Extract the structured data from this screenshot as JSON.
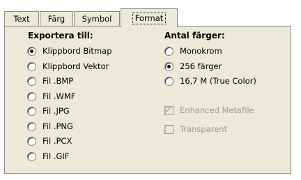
{
  "tabs": [
    {
      "label": "Text"
    },
    {
      "label": "Färg"
    },
    {
      "label": "Symbol"
    },
    {
      "label": "Format"
    }
  ],
  "export": {
    "title": "Exportera till:",
    "options": [
      {
        "label": "Klippbord Bitmap",
        "checked": true
      },
      {
        "label": "Klippbord Vektor",
        "checked": false
      },
      {
        "label": "Fil .BMP",
        "checked": false
      },
      {
        "label": "Fil .WMF",
        "checked": false
      },
      {
        "label": "Fil .JPG",
        "checked": false
      },
      {
        "label": "Fil .PNG",
        "checked": false
      },
      {
        "label": "Fil .PCX",
        "checked": false
      },
      {
        "label": "Fil .GIF",
        "checked": false
      }
    ]
  },
  "colors": {
    "title": "Antal färger:",
    "options": [
      {
        "label": "Monokrom",
        "checked": false
      },
      {
        "label": "256 färger",
        "checked": true
      },
      {
        "label": "16,7 M (True Color)",
        "checked": false
      }
    ]
  },
  "checkboxes": [
    {
      "label": "Enhanced Metafile",
      "checked": true,
      "disabled": true
    },
    {
      "label": "Transparent",
      "checked": false,
      "disabled": true
    }
  ]
}
